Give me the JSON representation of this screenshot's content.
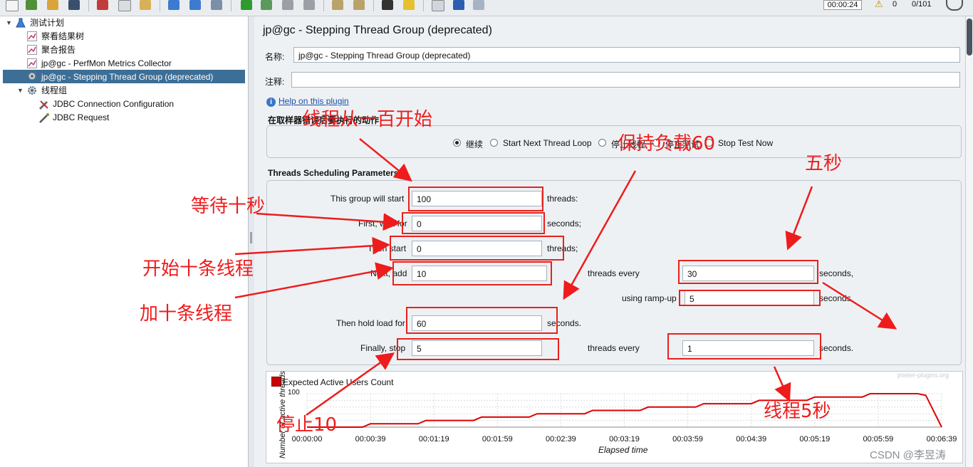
{
  "toolbar": {
    "timer": "00:00:24",
    "warn_count": "0",
    "threads": "0/101"
  },
  "tree": {
    "root": "测试计划",
    "items": [
      {
        "label": "察看结果树"
      },
      {
        "label": "聚合报告"
      },
      {
        "label": "jp@gc - PerfMon Metrics Collector"
      },
      {
        "label": "jp@gc - Stepping Thread Group (deprecated)"
      },
      {
        "label": "线程组"
      },
      {
        "label": "JDBC Connection Configuration"
      },
      {
        "label": "JDBC Request"
      }
    ]
  },
  "panel": {
    "title": "jp@gc - Stepping Thread Group (deprecated)",
    "name_label": "名称:",
    "name_value": "jp@gc - Stepping Thread Group (deprecated)",
    "comment_label": "注释:",
    "comment_value": "",
    "help_link": "Help on this plugin",
    "action_group_title": "在取样器错误后要执行的动作",
    "actions": [
      {
        "label": "继续",
        "selected": true
      },
      {
        "label": "Start Next Thread Loop",
        "selected": false
      },
      {
        "label": "停止线程",
        "selected": false
      },
      {
        "label": "停止测试",
        "selected": false
      },
      {
        "label": "Stop Test Now",
        "selected": false
      }
    ],
    "sched_title": "Threads Scheduling Parameters",
    "rows": {
      "start_label": "This group will start",
      "start_value": "100",
      "start_unit": "threads:",
      "wait_label": "First, wait for",
      "wait_value": "0",
      "wait_unit": "seconds;",
      "then_label": "Then start",
      "then_value": "0",
      "then_unit": "threads;",
      "next_label": "Next, add",
      "next_value": "10",
      "next_mid": "threads every",
      "next_every": "30",
      "next_unit": "seconds,",
      "ramp_label": "using ramp-up",
      "ramp_value": "5",
      "ramp_unit": "seconds.",
      "hold_label": "Then hold load for",
      "hold_value": "60",
      "hold_unit": "seconds.",
      "stop_label": "Finally, stop",
      "stop_value": "5",
      "stop_mid": "threads every",
      "stop_every": "1",
      "stop_unit": "seconds."
    }
  },
  "chart_data": {
    "type": "line",
    "title": "",
    "legend": "Expected Active Users Count",
    "watermark": "jmeter-plugins.org",
    "xlabel": "Elapsed time",
    "ylabel": "Number of active threads",
    "y_tick_top": "100",
    "x_ticks": [
      "00:00:00",
      "00:00:39",
      "00:01:19",
      "00:01:59",
      "00:02:39",
      "00:03:19",
      "00:03:59",
      "00:04:39",
      "00:05:19",
      "00:05:59",
      "00:06:39"
    ],
    "series": [
      {
        "name": "Expected Active Users Count",
        "color": "#e00000",
        "x": [
          0,
          35,
          40,
          70,
          75,
          105,
          110,
          140,
          145,
          175,
          180,
          210,
          215,
          245,
          250,
          280,
          285,
          315,
          320,
          350,
          355,
          385,
          390,
          400
        ],
        "y": [
          0,
          0,
          10,
          10,
          20,
          20,
          30,
          30,
          40,
          40,
          50,
          50,
          60,
          60,
          70,
          70,
          80,
          80,
          90,
          90,
          100,
          100,
          95,
          0
        ]
      }
    ],
    "xlim": [
      0,
      400
    ],
    "ylim": [
      0,
      100
    ]
  },
  "annotations": {
    "a1": "线程从一百开始",
    "a2": "保持负载60",
    "a3": "五秒",
    "a4": "等待十秒",
    "a5": "开始十条线程",
    "a6": "加十条线程",
    "a7": "停止10",
    "a8": "线程5秒"
  },
  "watermark": "CSDN @李昱涛"
}
